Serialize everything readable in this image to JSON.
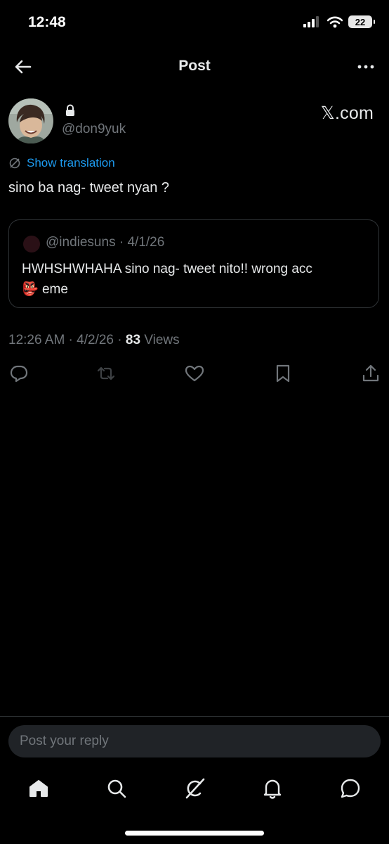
{
  "status_bar": {
    "time": "12:48",
    "battery": "22"
  },
  "header": {
    "title": "Post",
    "back_icon": "arrow-left-icon",
    "more_icon": "more-icon"
  },
  "author": {
    "handle": "@don9yuk",
    "protected": true,
    "source": "𝕏.com"
  },
  "tweet": {
    "translation_label": "Show translation",
    "text": "sino ba nag- tweet nyan ?"
  },
  "quote": {
    "handle": "@indiesuns",
    "date": "4/1/26",
    "line1": "HWHSHWHAHA sino nag- tweet nito!! wrong acc",
    "emoji": "👺",
    "line2": "eme"
  },
  "meta": {
    "time": "12:26 AM",
    "date": "4/2/26",
    "views_count": "83",
    "views_label": "Views"
  },
  "actions": [
    "reply-icon",
    "retweet-icon",
    "like-icon",
    "bookmark-icon",
    "share-icon"
  ],
  "reply_box": {
    "placeholder": "Post your reply"
  },
  "bottom_nav": [
    "home-icon",
    "search-icon",
    "grok-icon",
    "notifications-icon",
    "messages-icon"
  ],
  "colors": {
    "background": "#000000",
    "accent": "#1d9bf0",
    "muted": "#71767b",
    "text": "#e7e9ea",
    "border": "#2f3336"
  }
}
